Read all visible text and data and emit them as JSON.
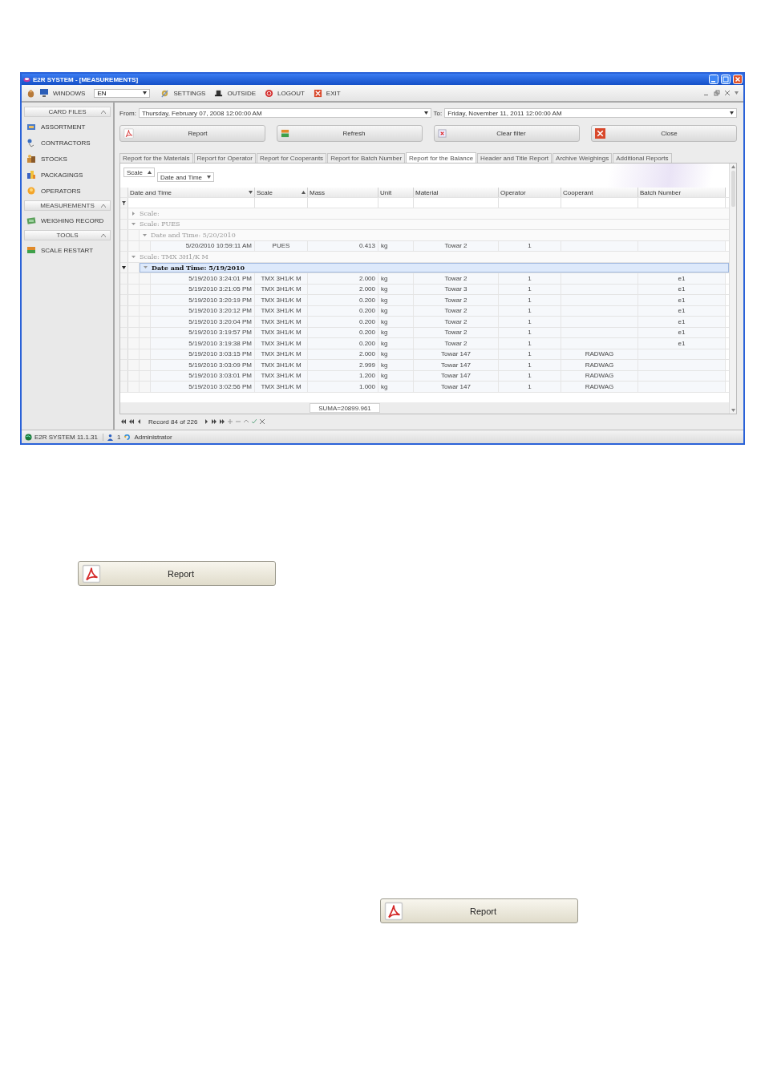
{
  "window": {
    "title": "E2R SYSTEM - [MEASUREMENTS]"
  },
  "toolbar": {
    "windows": "WINDOWS",
    "language": "EN",
    "items": [
      "SETTINGS",
      "OUTSIDE",
      "LOGOUT",
      "EXIT"
    ]
  },
  "sidebar": {
    "sections": [
      {
        "title": "CARD FILES",
        "expanded": true,
        "items": [
          "ASSORTMENT",
          "CONTRACTORS",
          "STOCKS",
          "PACKAGINGS",
          "OPERATORS"
        ]
      },
      {
        "title": "MEASUREMENTS",
        "expanded": true,
        "items": [
          "WEIGHING RECORD"
        ]
      },
      {
        "title": "TOOLS",
        "expanded": true,
        "items": [
          "SCALE RESTART"
        ]
      }
    ]
  },
  "filter": {
    "from_label": "From:",
    "from": "Thursday, February 07, 2008 12:00:00 AM",
    "to_label": "To:",
    "to": "Friday, November 11, 2011 12:00:00 AM"
  },
  "buttons": [
    "Report",
    "Refresh",
    "Clear filter",
    "Close"
  ],
  "tabs": [
    {
      "label": "Report for the Materials",
      "selected": false
    },
    {
      "label": "Report for Operator",
      "selected": false
    },
    {
      "label": "Report for Cooperants",
      "selected": false
    },
    {
      "label": "Report for Batch Number",
      "selected": false
    },
    {
      "label": "Report for the Balance",
      "selected": true
    },
    {
      "label": "Header and Title Report",
      "selected": false
    },
    {
      "label": "Archive Weighings",
      "selected": false
    },
    {
      "label": "Additional Reports",
      "selected": false
    }
  ],
  "group_by": [
    {
      "label": "Scale",
      "descending": false
    },
    {
      "label": "Date and Time",
      "descending": true
    }
  ],
  "columns": [
    {
      "label": "Date and Time",
      "descending": true
    },
    {
      "label": "Scale",
      "descending": false
    },
    {
      "label": "Mass"
    },
    {
      "label": "Unit"
    },
    {
      "label": "Material"
    },
    {
      "label": "Operator"
    },
    {
      "label": "Cooperant"
    },
    {
      "label": "Batch Number"
    }
  ],
  "groups": [
    {
      "label": "Scale:",
      "expanded": false,
      "selected": false
    },
    {
      "label": "Scale: PUES",
      "expanded": true,
      "selected": false,
      "children": [
        {
          "label": "Date and Time: 5/20/2010",
          "expanded": true,
          "selected": false,
          "rows": [
            {
              "date": "5/20/2010 10:59:11 AM",
              "scale": "PUES",
              "mass": "0.413",
              "unit": "kg",
              "material": "Towar 2",
              "operator": "1"
            }
          ]
        }
      ]
    },
    {
      "label": "Scale: TMX 3H1/K M",
      "expanded": true,
      "selected": false,
      "children": [
        {
          "label": "Date and Time: 5/19/2010",
          "expanded": true,
          "selected": true,
          "rows": [
            {
              "date": "5/19/2010 3:24:01 PM",
              "scale": "TMX 3H1/K M",
              "mass": "2.000",
              "unit": "kg",
              "material": "Towar 2",
              "operator": "1",
              "batch": "e1"
            },
            {
              "date": "5/19/2010 3:21:05 PM",
              "scale": "TMX 3H1/K M",
              "mass": "2.000",
              "unit": "kg",
              "material": "Towar 3",
              "operator": "1",
              "batch": "e1"
            },
            {
              "date": "5/19/2010 3:20:19 PM",
              "scale": "TMX 3H1/K M",
              "mass": "0.200",
              "unit": "kg",
              "material": "Towar 2",
              "operator": "1",
              "batch": "e1"
            },
            {
              "date": "5/19/2010 3:20:12 PM",
              "scale": "TMX 3H1/K M",
              "mass": "0.200",
              "unit": "kg",
              "material": "Towar 2",
              "operator": "1",
              "batch": "e1"
            },
            {
              "date": "5/19/2010 3:20:04 PM",
              "scale": "TMX 3H1/K M",
              "mass": "0.200",
              "unit": "kg",
              "material": "Towar 2",
              "operator": "1",
              "batch": "e1"
            },
            {
              "date": "5/19/2010 3:19:57 PM",
              "scale": "TMX 3H1/K M",
              "mass": "0.200",
              "unit": "kg",
              "material": "Towar 2",
              "operator": "1",
              "batch": "e1"
            },
            {
              "date": "5/19/2010 3:19:38 PM",
              "scale": "TMX 3H1/K M",
              "mass": "0.200",
              "unit": "kg",
              "material": "Towar 2",
              "operator": "1",
              "batch": "e1"
            },
            {
              "date": "5/19/2010 3:03:15 PM",
              "scale": "TMX 3H1/K M",
              "mass": "2.000",
              "unit": "kg",
              "material": "Towar 147",
              "operator": "1",
              "cooperant": "RADWAG"
            },
            {
              "date": "5/19/2010 3:03:09 PM",
              "scale": "TMX 3H1/K M",
              "mass": "2.999",
              "unit": "kg",
              "material": "Towar 147",
              "operator": "1",
              "cooperant": "RADWAG"
            },
            {
              "date": "5/19/2010 3:03:01 PM",
              "scale": "TMX 3H1/K M",
              "mass": "1.200",
              "unit": "kg",
              "material": "Towar 147",
              "operator": "1",
              "cooperant": "RADWAG"
            },
            {
              "date": "5/19/2010 3:02:56 PM",
              "scale": "TMX 3H1/K M",
              "mass": "1.000",
              "unit": "kg",
              "material": "Towar 147",
              "operator": "1",
              "cooperant": "RADWAG"
            }
          ]
        }
      ]
    }
  ],
  "footer": {
    "mass_total": "SUMA=20899.961"
  },
  "navigator": {
    "record": "Record 84 of 226"
  },
  "status_bar": {
    "version": "E2R SYSTEM 11.1.31",
    "users": "1",
    "user": "Administrator"
  },
  "report_buttons": [
    {
      "label": "Report"
    },
    {
      "label": "Report"
    }
  ]
}
